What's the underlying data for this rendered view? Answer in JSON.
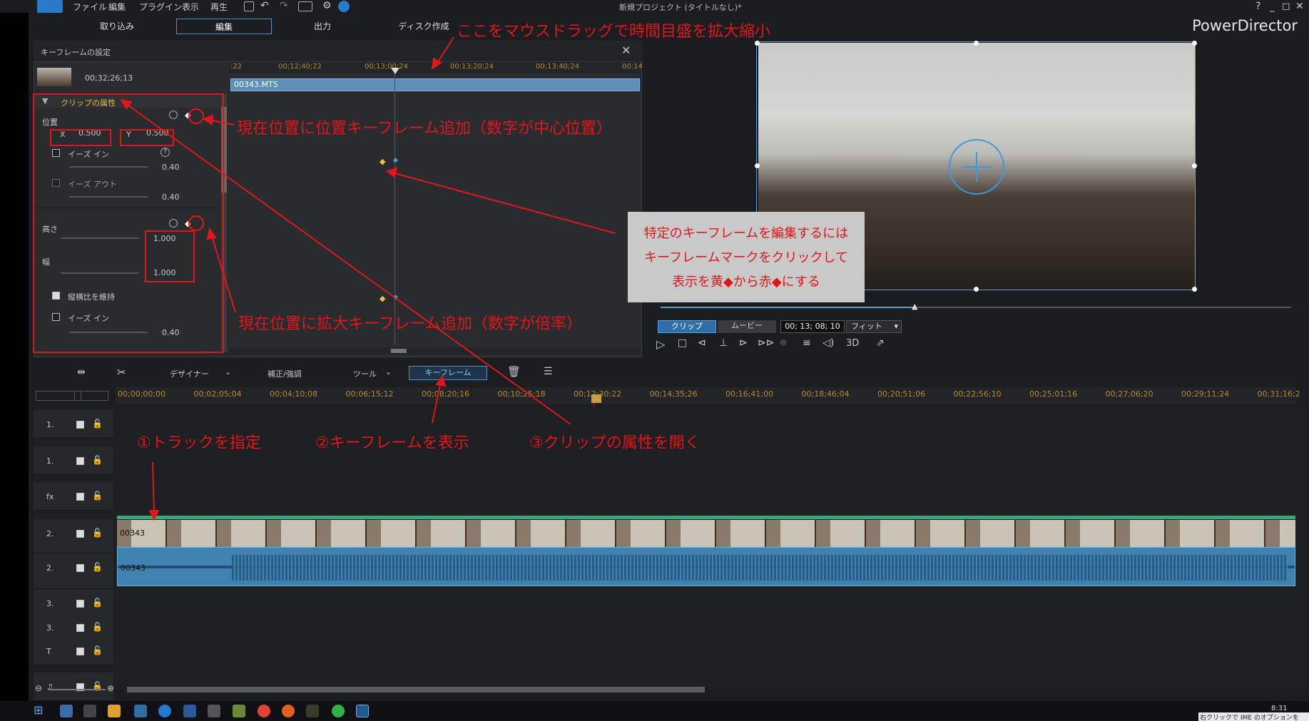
{
  "menu": {
    "items": [
      "ファイル",
      "編集",
      "プラグイン",
      "表示",
      "再生"
    ],
    "title": "新規プロジェクト (タイトルなし)*",
    "window_controls": [
      "?",
      "_",
      "◻",
      "✕"
    ]
  },
  "modes": {
    "items": [
      "取り込み",
      "編集",
      "出力",
      "ディスク作成"
    ],
    "active": "編集"
  },
  "brand": "PowerDirector",
  "keyframe_panel": {
    "title": "キーフレームの設定",
    "clip_time": "00;32;26;13",
    "ruler_ticks": [
      ":22",
      "00;12;40;22",
      "00;13;00;24",
      "00;13;20;24",
      "00;13;40;24",
      "00;14"
    ],
    "clip_name": "00343.MTS",
    "clip_attributes": "クリップの属性",
    "position": {
      "label": "位置",
      "x_label": "X",
      "x": "0.500",
      "y_label": "Y",
      "y": "0.500",
      "ease_in": "イーズ イン",
      "ease_in_value": "0.40",
      "ease_out": "イーズ アウト",
      "ease_out_value": "0.40"
    },
    "height": {
      "label": "高さ",
      "value": "1.000"
    },
    "width": {
      "label": "幅",
      "value": "1.000"
    },
    "keep_ratio": "縦横比を維持",
    "ease_in2": "イーズ イン",
    "ease_in2_value": "0.40"
  },
  "preview": {
    "tab_clip": "クリップ",
    "tab_movie": "ムービー",
    "timecode": "00; 13; 08; 10",
    "fit": "フィット",
    "mode3d": "3D"
  },
  "toolbar": {
    "designer": "デザイナー",
    "correction": "補正/強調",
    "tools": "ツール",
    "keyframe": "キーフレーム"
  },
  "timeline": {
    "ticks": [
      "00;00;00;00",
      "00;02;05;04",
      "00;04;10;08",
      "00;06;15;12",
      "00;08;20;16",
      "00;10;25;18",
      "00;12;30;22",
      "00;14;35;26",
      "00;16;41;00",
      "00;18;46;04",
      "00;20;51;06",
      "00;22;56;10",
      "00;25;01;16",
      "00;27;06;20",
      "00;29;11;24",
      "00;31;16;2"
    ],
    "tracks": [
      "1.",
      "1.",
      "fx",
      "2.",
      "2.",
      "3.",
      "3.",
      "T",
      "♫"
    ],
    "clip_video": "00343",
    "clip_audio": "00343"
  },
  "annotations": {
    "zoom": "ここをマウスドラッグで時間目盛を拡大縮小",
    "pos_kf": "現在位置に位置キーフレーム追加（数字が中心位置）",
    "scale_kf": "現在位置に拡大キーフレーム追加（数字が倍率）",
    "edit_kf_1": "特定のキーフレームを編集するには",
    "edit_kf_2": "キーフレームマークをクリックして",
    "edit_kf_3": "表示を黄◆から赤◆にする",
    "step1": "①トラックを指定",
    "step2": "②キーフレームを表示",
    "step3": "③クリップの属性を開く"
  },
  "taskbar": {
    "time": "8:31",
    "ime": "右クリックで IME のオプションを"
  }
}
